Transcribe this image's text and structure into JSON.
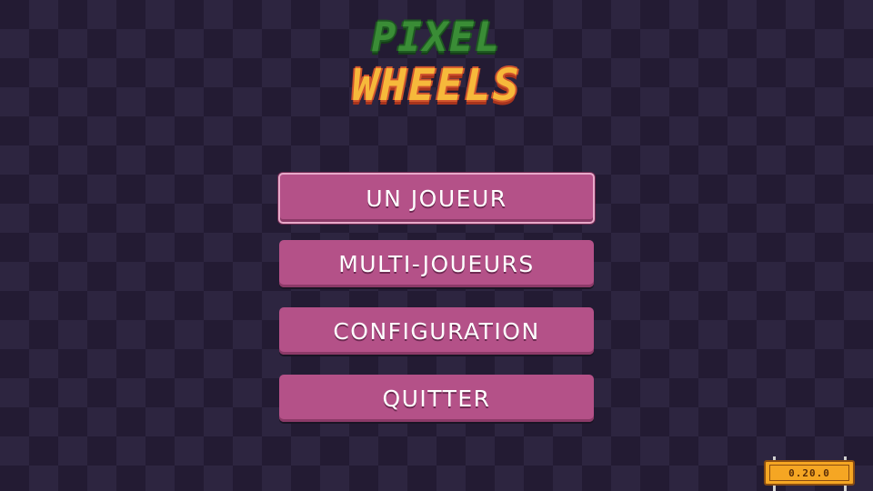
{
  "logo": {
    "line1": "PIXEL",
    "line2": "WHEELS"
  },
  "menu": {
    "items": [
      {
        "label": "UN JOUEUR",
        "selected": true
      },
      {
        "label": "MULTI-JOUEURS",
        "selected": false
      },
      {
        "label": "CONFIGURATION",
        "selected": false
      },
      {
        "label": "QUITTER",
        "selected": false
      }
    ]
  },
  "version": {
    "text": "0.20.0"
  },
  "colors": {
    "background_dark": "#231b33",
    "background_light": "#2d2540",
    "button": "#b45188",
    "logo_green": "#3a8d36",
    "logo_orange": "#f6b93b",
    "sign": "#f5a623"
  }
}
